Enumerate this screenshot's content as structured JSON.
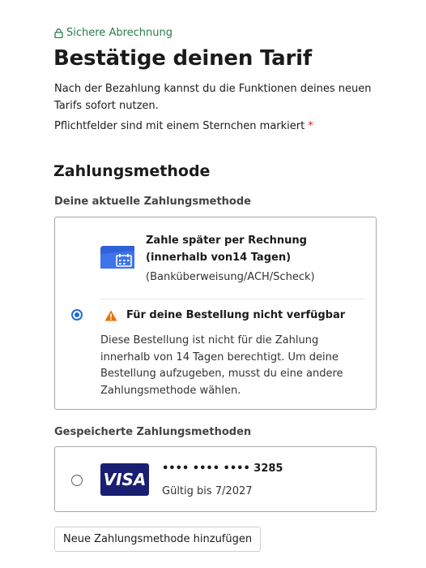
{
  "header": {
    "secure_label": "Sichere Abrechnung",
    "title": "Bestätige deinen Tarif",
    "intro": "Nach der Bezahlung kannst du die Funktionen deines neuen Tarifs sofort nutzen.",
    "required_note": "Pflichtfelder sind mit einem Sternchen markiert",
    "required_star": "*"
  },
  "payment": {
    "heading": "Zahlungsmethode",
    "current_label": "Deine aktuelle Zahlungsmethode",
    "current_method": {
      "title": "Zahle später per Rechnung (innerhalb von14 Tagen)",
      "subtitle": "(Banküberweisung/ACH/Scheck)",
      "selected": true,
      "warning_title": "Für deine Bestellung nicht verfügbar",
      "warning_text": "Diese Bestellung ist nicht für die Zahlung innerhalb von 14 Tagen berechtigt. Um deine Bestellung aufzugeben, musst du eine andere Zahlungsmethode wählen."
    },
    "saved_label": "Gespeicherte Zahlungsmethoden",
    "saved_methods": [
      {
        "brand": "VISA",
        "number": "•••• •••• •••• 3285",
        "expiry": "Gültig bis 7/2027",
        "selected": false
      }
    ],
    "add_button": "Neue Zahlungsmethode hinzufügen"
  },
  "colors": {
    "secure_green": "#2a7a4a",
    "radio_blue": "#1f6ad6",
    "warning_orange": "#e8710a",
    "visa_blue": "#1a1f71",
    "invoice_blue": "#2f62d9",
    "required_red": "#c42b1c"
  },
  "icons": {
    "secure": "lock-icon",
    "invoice": "invoice-calendar-icon",
    "warning": "warning-icon",
    "card": "visa-logo"
  }
}
